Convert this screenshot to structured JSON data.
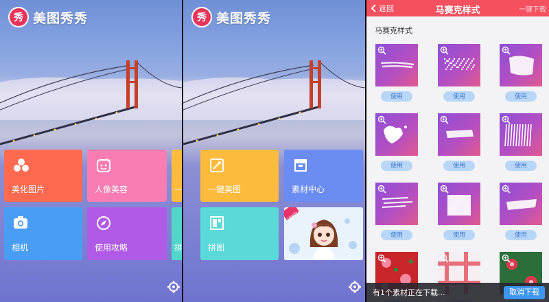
{
  "left_screen": {
    "logo_char": "秀",
    "app_name": "美图秀秀",
    "tiles": [
      {
        "label": "美化图片",
        "color": "#fe6a50",
        "icon": "circles-icon"
      },
      {
        "label": "人像美容",
        "color": "#f97cb2",
        "icon": "face-icon"
      },
      {
        "label": "相机",
        "color": "#4a9df5",
        "icon": "camera-icon"
      },
      {
        "label": "使用攻略",
        "color": "#b05be8",
        "icon": "compass-icon"
      },
      {
        "label": "一",
        "color": "#fdbb3e",
        "icon": "partial-icon"
      },
      {
        "label": "拼",
        "color": "#52d6ca",
        "icon": "partial-icon"
      }
    ]
  },
  "middle_screen": {
    "logo_char": "秀",
    "app_name": "美图秀秀",
    "tiles": [
      {
        "label": "一键美图",
        "color": "#fdbb3e",
        "icon": "magic-icon"
      },
      {
        "label": "素材中心",
        "color": "#6b8cf2",
        "icon": "store-icon"
      },
      {
        "label": "拼图",
        "color": "#5ad9d8",
        "icon": "collage-icon"
      },
      {
        "label": "",
        "color": "#e9f3fc",
        "icon": "cartoon-girl-icon"
      }
    ],
    "banner_badge": "meitu"
  },
  "right_screen": {
    "back_label": "返回",
    "title": "马赛克样式",
    "download_all": "一键下载",
    "section_title": "马赛克样式",
    "use_label": "使用",
    "items": [
      {
        "style": "streak"
      },
      {
        "style": "dots"
      },
      {
        "style": "blob"
      },
      {
        "style": "splash"
      },
      {
        "style": "stroke"
      },
      {
        "style": "lines"
      },
      {
        "style": "dash"
      },
      {
        "style": "block"
      },
      {
        "style": "brush"
      },
      {
        "style": "floral-red"
      },
      {
        "style": "plaid"
      },
      {
        "style": "floral-green"
      }
    ],
    "toast_text": "有1个素材正在下载...",
    "cancel_label": "取消下载"
  },
  "colors": {
    "accent_red": "#f4505f",
    "use_button": "#b8d6f7",
    "cancel_button": "#3d95ef"
  }
}
